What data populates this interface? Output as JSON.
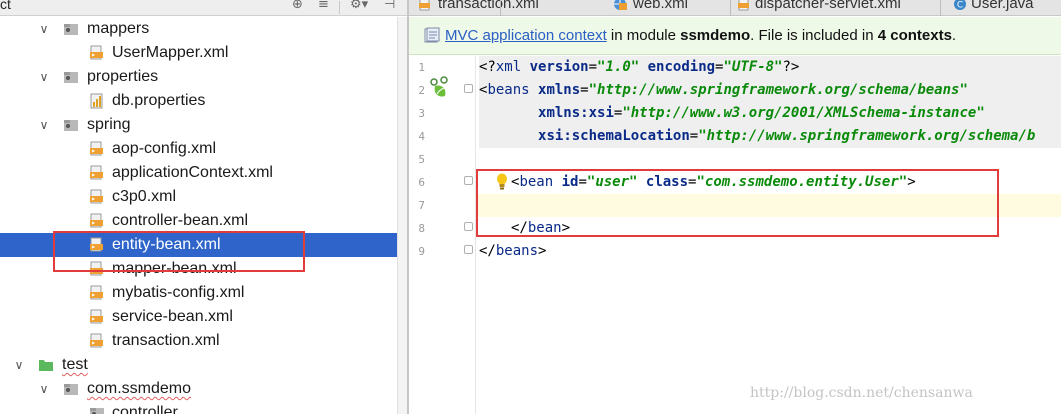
{
  "project_panel": {
    "title": "ct",
    "tree": [
      {
        "label": "mappers",
        "type": "package",
        "expanded": true
      },
      {
        "label": "UserMapper.xml",
        "type": "xml"
      },
      {
        "label": "properties",
        "type": "package",
        "expanded": true
      },
      {
        "label": "db.properties",
        "type": "properties"
      },
      {
        "label": "spring",
        "type": "package",
        "expanded": true
      },
      {
        "label": "aop-config.xml",
        "type": "xml"
      },
      {
        "label": "applicationContext.xml",
        "type": "xml"
      },
      {
        "label": "c3p0.xml",
        "type": "xml"
      },
      {
        "label": "controller-bean.xml",
        "type": "xml"
      },
      {
        "label": "entity-bean.xml",
        "type": "xml",
        "selected": true
      },
      {
        "label": "mapper-bean.xml",
        "type": "xml"
      },
      {
        "label": "mybatis-config.xml",
        "type": "xml"
      },
      {
        "label": "service-bean.xml",
        "type": "xml"
      },
      {
        "label": "transaction.xml",
        "type": "xml"
      },
      {
        "label": "test",
        "type": "folder-green",
        "expanded": true
      },
      {
        "label": "com.ssmdemo",
        "type": "package",
        "expanded": true
      },
      {
        "label": "controller",
        "type": "package"
      }
    ]
  },
  "editor": {
    "tabs": [
      {
        "label": "transaction.xml",
        "icon": "xml-file-icon"
      },
      {
        "label": "web.xml",
        "icon": "web-xml-icon"
      },
      {
        "label": "dispatcher-servlet.xml",
        "icon": "xml-file-icon"
      },
      {
        "label": "User.java",
        "icon": "java-class-icon"
      }
    ],
    "banner": {
      "link": "MVC application context",
      "text1": " in module ",
      "module": "ssmdemo",
      "text2": ". File is included in ",
      "count": "4 contexts",
      "text3": "."
    },
    "line_numbers": [
      "1",
      "2",
      "3",
      "4",
      "5",
      "6",
      "7",
      "8",
      "9"
    ],
    "code": {
      "l1_a": "<?",
      "l1_b": "xml ",
      "l1_c": "version",
      "l1_d": "=",
      "l1_e": "\"1.0\"",
      "l1_f": " encoding",
      "l1_g": "=",
      "l1_h": "\"UTF-8\"",
      "l1_i": "?>",
      "l2_a": "<",
      "l2_b": "beans ",
      "l2_c": "xmlns",
      "l2_d": "=",
      "l2_e": "\"http://www.springframework.org/schema/beans\"",
      "l3_a": "       ",
      "l3_b": "xmlns:",
      "l3_c": "xsi",
      "l3_d": "=",
      "l3_e": "\"http://www.w3.org/2001/XMLSchema-instance\"",
      "l4_a": "       ",
      "l4_b": "xsi",
      "l4_c": ":schemaLocation",
      "l4_d": "=",
      "l4_e": "\"http://www.springframework.org/schema/b",
      "l6_a": "<",
      "l6_b": "bean ",
      "l6_c": "id",
      "l6_d": "=",
      "l6_e": "\"user\"",
      "l6_f": " class",
      "l6_g": "=",
      "l6_h": "\"com.ssmdemo.entity.User\"",
      "l6_i": ">",
      "l8_a": "</",
      "l8_b": "bean",
      "l8_c": ">",
      "l9_a": "</",
      "l9_b": "beans",
      "l9_c": ">"
    }
  },
  "watermark": "http://blog.csdn.net/chensanwa",
  "colors": {
    "selection": "#2f65ca",
    "highlight_box": "#e23b3b",
    "banner_bg": "#eef9e8",
    "link": "#2a5fc4",
    "xml_value": "#0a8a0a",
    "xml_tag": "#0a2a88"
  }
}
